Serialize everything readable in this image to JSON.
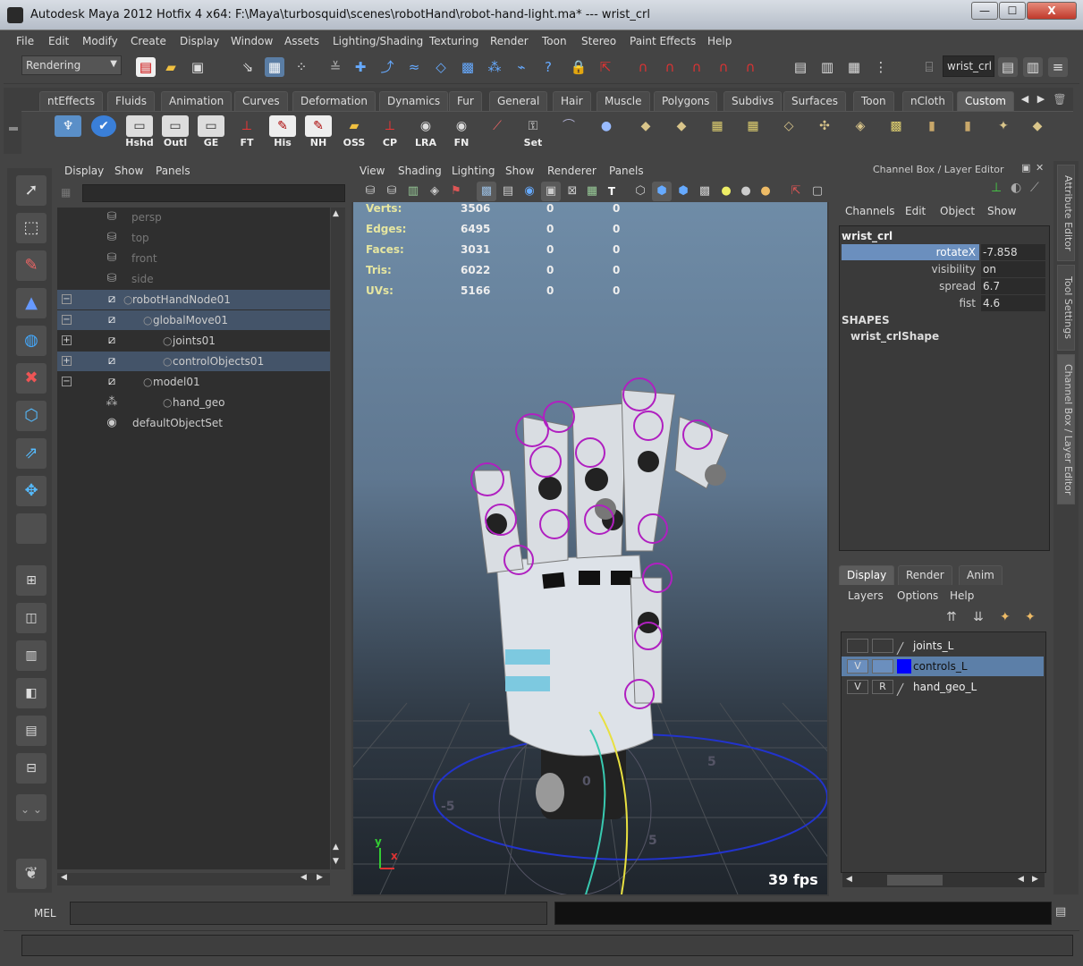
{
  "window": {
    "title": "Autodesk Maya 2012 Hotfix 4 x64: F:\\Maya\\turbosquid\\scenes\\robotHand\\robot-hand-light.ma*   ---   wrist_crl",
    "min": "—",
    "max": "☐",
    "close": "X"
  },
  "menubar": [
    "File",
    "Edit",
    "Modify",
    "Create",
    "Display",
    "Window",
    "Assets",
    "Lighting/Shading",
    "Texturing",
    "Render",
    "Toon",
    "Stereo",
    "Paint Effects",
    "Help"
  ],
  "statusline": {
    "menuset": "Rendering",
    "object_field": "wrist_crl"
  },
  "shelf": {
    "tabs": [
      "ntEffects",
      "Fluids",
      "Animation",
      "Curves",
      "Deformation",
      "Dynamics",
      "Fur",
      "General",
      "Hair",
      "Muscle",
      "Polygons",
      "Subdivs",
      "Surfaces",
      "Toon",
      "nCloth",
      "Custom"
    ],
    "active_tab": "Custom",
    "buttons": [
      "Hshd",
      "Outl",
      "GE",
      "FT",
      "His",
      "NH",
      "OSS",
      "CP",
      "LRA",
      "FN",
      "Set"
    ]
  },
  "outliner": {
    "menu": [
      "Display",
      "Show",
      "Panels"
    ],
    "items": [
      {
        "label": "persp",
        "dim": true
      },
      {
        "label": "top",
        "dim": true
      },
      {
        "label": "front",
        "dim": true
      },
      {
        "label": "side",
        "dim": true
      },
      {
        "label": "robotHandNode01"
      },
      {
        "label": "globalMove01"
      },
      {
        "label": "joints01"
      },
      {
        "label": "controlObjects01"
      },
      {
        "label": "model01"
      },
      {
        "label": "hand_geo"
      },
      {
        "label": "defaultObjectSet"
      }
    ]
  },
  "viewport": {
    "menu": [
      "View",
      "Shading",
      "Lighting",
      "Show",
      "Renderer",
      "Panels"
    ],
    "hud": [
      {
        "label": "Verts:",
        "values": [
          "3506",
          "0",
          "0"
        ]
      },
      {
        "label": "Edges:",
        "values": [
          "6495",
          "0",
          "0"
        ]
      },
      {
        "label": "Faces:",
        "values": [
          "3031",
          "0",
          "0"
        ]
      },
      {
        "label": "Tris:",
        "values": [
          "6022",
          "0",
          "0"
        ]
      },
      {
        "label": "UVs:",
        "values": [
          "5166",
          "0",
          "0"
        ]
      }
    ],
    "fps": "39 fps",
    "axis_y": "y",
    "axis_x": "x",
    "grid_labels": [
      "-5",
      "0",
      "5",
      "5"
    ]
  },
  "channelbox": {
    "header": "Channel Box / Layer Editor",
    "menu": [
      "Channels",
      "Edit",
      "Object",
      "Show"
    ],
    "object": "wrist_crl",
    "channels": [
      {
        "name": "rotateX",
        "value": "-7.858"
      },
      {
        "name": "visibility",
        "value": "on"
      },
      {
        "name": "spread",
        "value": "6.7"
      },
      {
        "name": "fist",
        "value": "4.6"
      }
    ],
    "shapes_header": "SHAPES",
    "shape": "wrist_crlShape"
  },
  "layers": {
    "tabs": [
      "Display",
      "Render",
      "Anim"
    ],
    "menu": [
      "Layers",
      "Options",
      "Help"
    ],
    "items": [
      {
        "v": "",
        "r": "",
        "name": "joints_L",
        "color": ""
      },
      {
        "v": "V",
        "r": "",
        "name": "controls_L",
        "color": "#0000ff"
      },
      {
        "v": "V",
        "r": "R",
        "name": "hand_geo_L",
        "color": ""
      }
    ]
  },
  "side_tabs": [
    "Attribute Editor",
    "Tool Settings",
    "Channel Box / Layer Editor"
  ],
  "cmdline": {
    "label": "MEL"
  }
}
